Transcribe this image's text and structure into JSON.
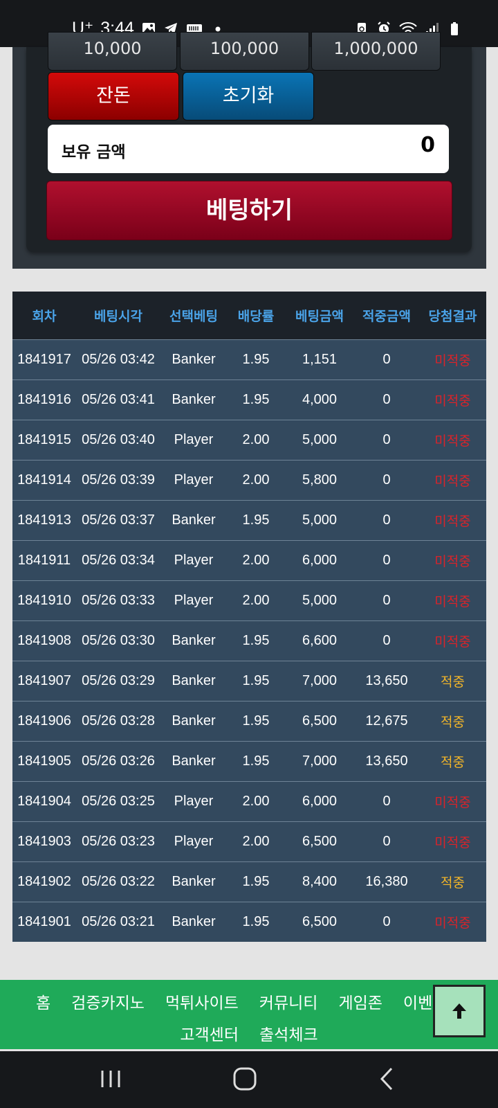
{
  "status_bar": {
    "carrier": "U⁺",
    "time": "3:44"
  },
  "chips": [
    "10,000",
    "100,000",
    "1,000,000"
  ],
  "buttons": {
    "balance": "잔돈",
    "reset": "초기화",
    "bet": "베팅하기"
  },
  "holding": {
    "label": "보유 금액",
    "value": "0"
  },
  "table": {
    "headers": [
      "회차",
      "베팅시각",
      "선택베팅",
      "배당률",
      "베팅금액",
      "적중금액",
      "당첨결과"
    ],
    "rows": [
      [
        "1841917",
        "05/26 03:42",
        "Banker",
        "1.95",
        "1,151",
        "0",
        "미적중"
      ],
      [
        "1841916",
        "05/26 03:41",
        "Banker",
        "1.95",
        "4,000",
        "0",
        "미적중"
      ],
      [
        "1841915",
        "05/26 03:40",
        "Player",
        "2.00",
        "5,000",
        "0",
        "미적중"
      ],
      [
        "1841914",
        "05/26 03:39",
        "Player",
        "2.00",
        "5,800",
        "0",
        "미적중"
      ],
      [
        "1841913",
        "05/26 03:37",
        "Banker",
        "1.95",
        "5,000",
        "0",
        "미적중"
      ],
      [
        "1841911",
        "05/26 03:34",
        "Player",
        "2.00",
        "6,000",
        "0",
        "미적중"
      ],
      [
        "1841910",
        "05/26 03:33",
        "Player",
        "2.00",
        "5,000",
        "0",
        "미적중"
      ],
      [
        "1841908",
        "05/26 03:30",
        "Banker",
        "1.95",
        "6,600",
        "0",
        "미적중"
      ],
      [
        "1841907",
        "05/26 03:29",
        "Banker",
        "1.95",
        "7,000",
        "13,650",
        "적중"
      ],
      [
        "1841906",
        "05/26 03:28",
        "Banker",
        "1.95",
        "6,500",
        "12,675",
        "적중"
      ],
      [
        "1841905",
        "05/26 03:26",
        "Banker",
        "1.95",
        "7,000",
        "13,650",
        "적중"
      ],
      [
        "1841904",
        "05/26 03:25",
        "Player",
        "2.00",
        "6,000",
        "0",
        "미적중"
      ],
      [
        "1841903",
        "05/26 03:23",
        "Player",
        "2.00",
        "6,500",
        "0",
        "미적중"
      ],
      [
        "1841902",
        "05/26 03:22",
        "Banker",
        "1.95",
        "8,400",
        "16,380",
        "적중"
      ],
      [
        "1841901",
        "05/26 03:21",
        "Banker",
        "1.95",
        "6,500",
        "0",
        "미적중"
      ]
    ]
  },
  "footer_nav": {
    "row1": [
      "홈",
      "검증카지노",
      "먹튀사이트",
      "커뮤니티",
      "게임존",
      "이벤트"
    ],
    "row2": [
      "고객센터",
      "출석체크"
    ]
  },
  "colors": {
    "win": "#f0b429",
    "loss": "#d9232a",
    "footer": "#1faa59",
    "header_text": "#4aa3e8"
  }
}
